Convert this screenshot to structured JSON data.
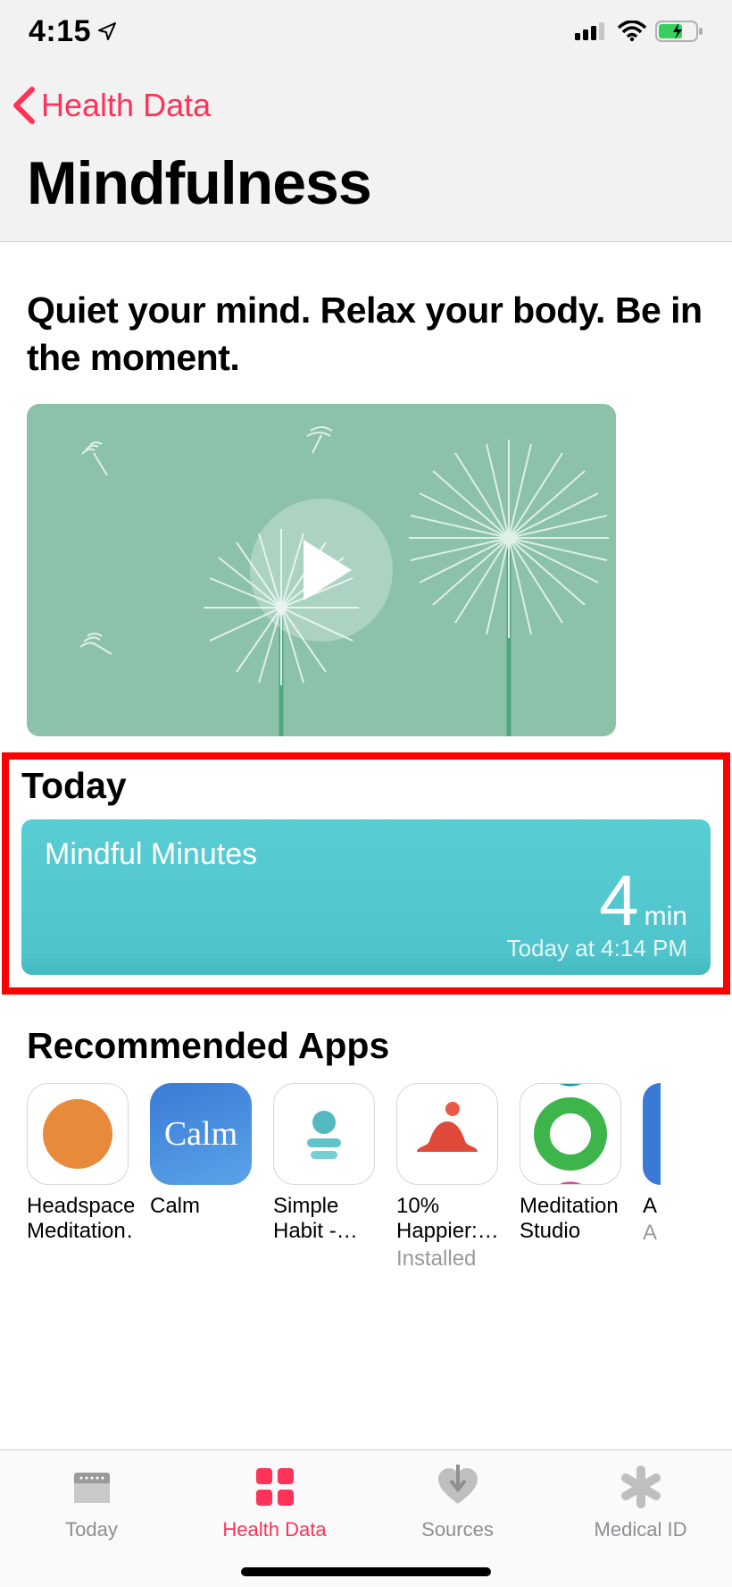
{
  "status": {
    "time": "4:15"
  },
  "nav": {
    "back_label": "Health Data",
    "title": "Mindfulness"
  },
  "hero": {
    "tagline": "Quiet your mind. Relax your body. Be in the moment."
  },
  "today": {
    "section_title": "Today",
    "card_title": "Mindful Minutes",
    "value": "4",
    "unit": "min",
    "timestamp": "Today at 4:14 PM"
  },
  "recommended": {
    "section_title": "Recommended Apps",
    "apps": [
      {
        "name": "Headspace: Meditation…",
        "sub": ""
      },
      {
        "name": "Calm",
        "sub": ""
      },
      {
        "name": "Simple Habit - Me…",
        "sub": ""
      },
      {
        "name": "10% Happier:…",
        "sub": "Installed"
      },
      {
        "name": "Meditation Studio",
        "sub": ""
      },
      {
        "name": "A",
        "sub": "A"
      }
    ]
  },
  "tabs": {
    "today": "Today",
    "healthdata": "Health Data",
    "sources": "Sources",
    "medicalid": "Medical ID"
  }
}
